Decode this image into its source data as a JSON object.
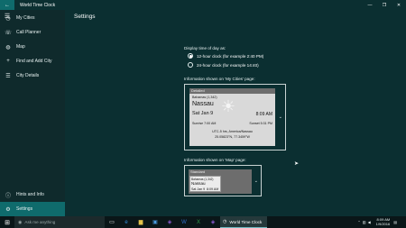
{
  "window": {
    "title": "World Time Clock",
    "controls": {
      "minimize": "—",
      "maximize": "❐",
      "close": "✕"
    }
  },
  "sidebar": {
    "items": [
      {
        "label": "My Cities",
        "icon": "clock-icon"
      },
      {
        "label": "Call Planner",
        "icon": "phone-icon"
      },
      {
        "label": "Map",
        "icon": "globe-icon"
      },
      {
        "label": "Find and Add City",
        "icon": "plus-icon"
      },
      {
        "label": "City Details",
        "icon": "list-icon"
      }
    ],
    "bottom": [
      {
        "label": "Hints and Info",
        "icon": "info-icon"
      },
      {
        "label": "Settings",
        "icon": "gear-icon"
      }
    ]
  },
  "page": {
    "title": "Settings",
    "display_time_label": "Display time of day as:",
    "radios": [
      {
        "label": "12-hour clock (for example 2:40 PM)",
        "checked": true
      },
      {
        "label": "24-hour clock (for example 14:40)",
        "checked": false
      }
    ],
    "my_cities_label": "Information shown on 'My Cities' page:",
    "detailed_card": {
      "band": "Detailed",
      "country": "Bahamas (1,342)",
      "city": "Nassau",
      "date": "Sat Jan 9",
      "time": "8:09 AM",
      "sunrise": "Sunrise 7:00 AM",
      "sunset": "Sunset 5:31 PM",
      "tz": "UTC-5 hrs, America/Nassau",
      "coords": "25.05823°N, 77.3459°W"
    },
    "map_label": "Information shown on 'Map' page:",
    "standard_card": {
      "band": "Standard",
      "country": "Bahamas (1,342)",
      "city": "Nassau",
      "date": "Sat Jan 9",
      "time": "8:09 AM"
    }
  },
  "taskbar": {
    "search_placeholder": "Ask me anything",
    "active_app": "World Time Clock",
    "time": "8:09 AM",
    "date": "1/9/2016"
  },
  "colors": {
    "background": "#0b2f31",
    "sidebar": "#0f2a2c",
    "accent": "#0f6b6c"
  }
}
